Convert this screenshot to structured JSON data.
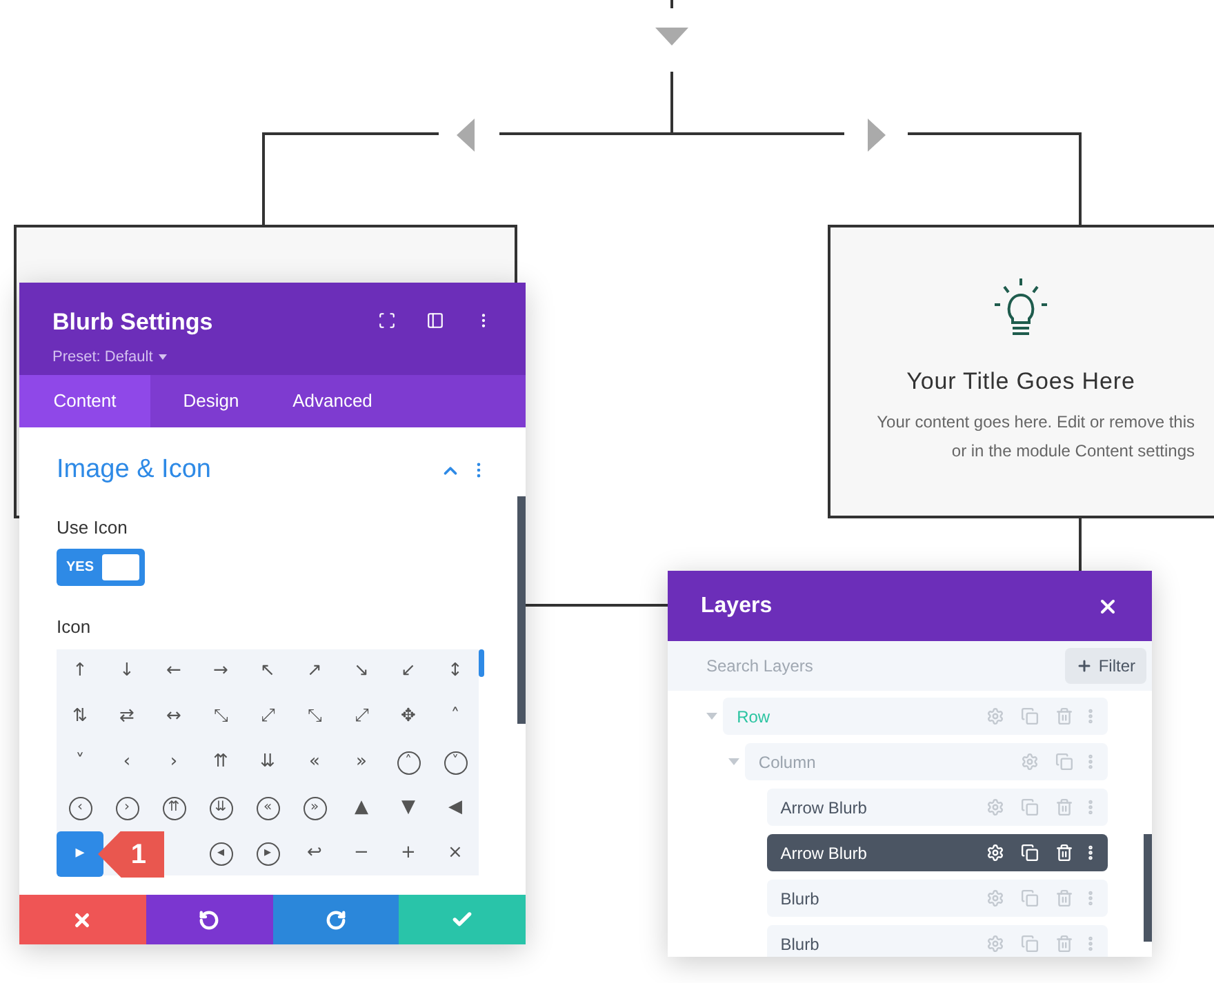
{
  "right_card": {
    "title": "Your Title Goes Here",
    "lines": [
      "Your content goes here. Edit or remove this",
      "or in the module Content settings"
    ]
  },
  "settings": {
    "title": "Blurb Settings",
    "preset": "Preset: Default",
    "tabs": [
      {
        "label": "Content",
        "selected": true
      },
      {
        "label": "Design",
        "selected": false
      },
      {
        "label": "Advanced",
        "selected": false
      }
    ],
    "section": {
      "title": "Image & Icon",
      "expanded": true
    },
    "use_icon": {
      "label": "Use Icon",
      "on": true,
      "on_text": "YES"
    },
    "icon_label": "Icon",
    "icons": [
      {
        "glyph": "↑",
        "circled": false,
        "selected": false
      },
      {
        "glyph": "↓",
        "circled": false,
        "selected": false
      },
      {
        "glyph": "←",
        "circled": false,
        "selected": false
      },
      {
        "glyph": "→",
        "circled": false,
        "selected": false
      },
      {
        "glyph": "↖",
        "circled": false,
        "selected": false
      },
      {
        "glyph": "↗",
        "circled": false,
        "selected": false
      },
      {
        "glyph": "↘",
        "circled": false,
        "selected": false
      },
      {
        "glyph": "↙",
        "circled": false,
        "selected": false
      },
      {
        "glyph": "↕",
        "circled": false,
        "selected": false
      },
      {
        "glyph": "⇅",
        "circled": false,
        "selected": false
      },
      {
        "glyph": "⇄",
        "circled": false,
        "selected": false
      },
      {
        "glyph": "↔",
        "circled": false,
        "selected": false
      },
      {
        "glyph": "⤡",
        "circled": false,
        "selected": false
      },
      {
        "glyph": "⤢",
        "circled": false,
        "selected": false
      },
      {
        "glyph": "⤡",
        "circled": false,
        "selected": false
      },
      {
        "glyph": "⤢",
        "circled": false,
        "selected": false
      },
      {
        "glyph": "✥",
        "circled": false,
        "selected": false
      },
      {
        "glyph": "˄",
        "circled": false,
        "selected": false
      },
      {
        "glyph": "˅",
        "circled": false,
        "selected": false
      },
      {
        "glyph": "‹",
        "circled": false,
        "selected": false
      },
      {
        "glyph": "›",
        "circled": false,
        "selected": false
      },
      {
        "glyph": "⇈",
        "circled": false,
        "selected": false
      },
      {
        "glyph": "⇊",
        "circled": false,
        "selected": false
      },
      {
        "glyph": "«",
        "circled": false,
        "selected": false
      },
      {
        "glyph": "»",
        "circled": false,
        "selected": false
      },
      {
        "glyph": "˄",
        "circled": true,
        "selected": false
      },
      {
        "glyph": "˅",
        "circled": true,
        "selected": false
      },
      {
        "glyph": "‹",
        "circled": true,
        "selected": false
      },
      {
        "glyph": "›",
        "circled": true,
        "selected": false
      },
      {
        "glyph": "⇈",
        "circled": true,
        "selected": false
      },
      {
        "glyph": "⇊",
        "circled": true,
        "selected": false
      },
      {
        "glyph": "«",
        "circled": true,
        "selected": false
      },
      {
        "glyph": "»",
        "circled": true,
        "selected": false
      },
      {
        "glyph": "▲",
        "circled": false,
        "selected": false
      },
      {
        "glyph": "▼",
        "circled": false,
        "selected": false
      },
      {
        "glyph": "◀",
        "circled": false,
        "selected": false
      },
      {
        "glyph": "▸",
        "circled": false,
        "selected": true
      },
      {
        "glyph": "◂",
        "circled": true,
        "selected": false
      },
      {
        "glyph": "▸",
        "circled": true,
        "selected": false
      },
      {
        "glyph": "↩",
        "circled": false,
        "selected": false
      },
      {
        "glyph": "−",
        "circled": false,
        "selected": false
      },
      {
        "glyph": "+",
        "circled": false,
        "selected": false
      },
      {
        "glyph": "×",
        "circled": false,
        "selected": false
      }
    ],
    "callout": "1"
  },
  "layers": {
    "title": "Layers",
    "search": {
      "placeholder": "Search Layers"
    },
    "filter": "Filter",
    "tree": [
      {
        "label": "Row",
        "kind": "row",
        "expanded": true,
        "selected": false,
        "children": [
          {
            "label": "Column",
            "kind": "column",
            "expanded": true,
            "selected": false,
            "children": [
              {
                "label": "Arrow Blurb",
                "kind": "module",
                "selected": false
              },
              {
                "label": "Arrow Blurb",
                "kind": "module",
                "selected": true
              },
              {
                "label": "Blurb",
                "kind": "module",
                "selected": false
              },
              {
                "label": "Blurb",
                "kind": "module",
                "selected": false
              }
            ]
          }
        ]
      }
    ]
  }
}
